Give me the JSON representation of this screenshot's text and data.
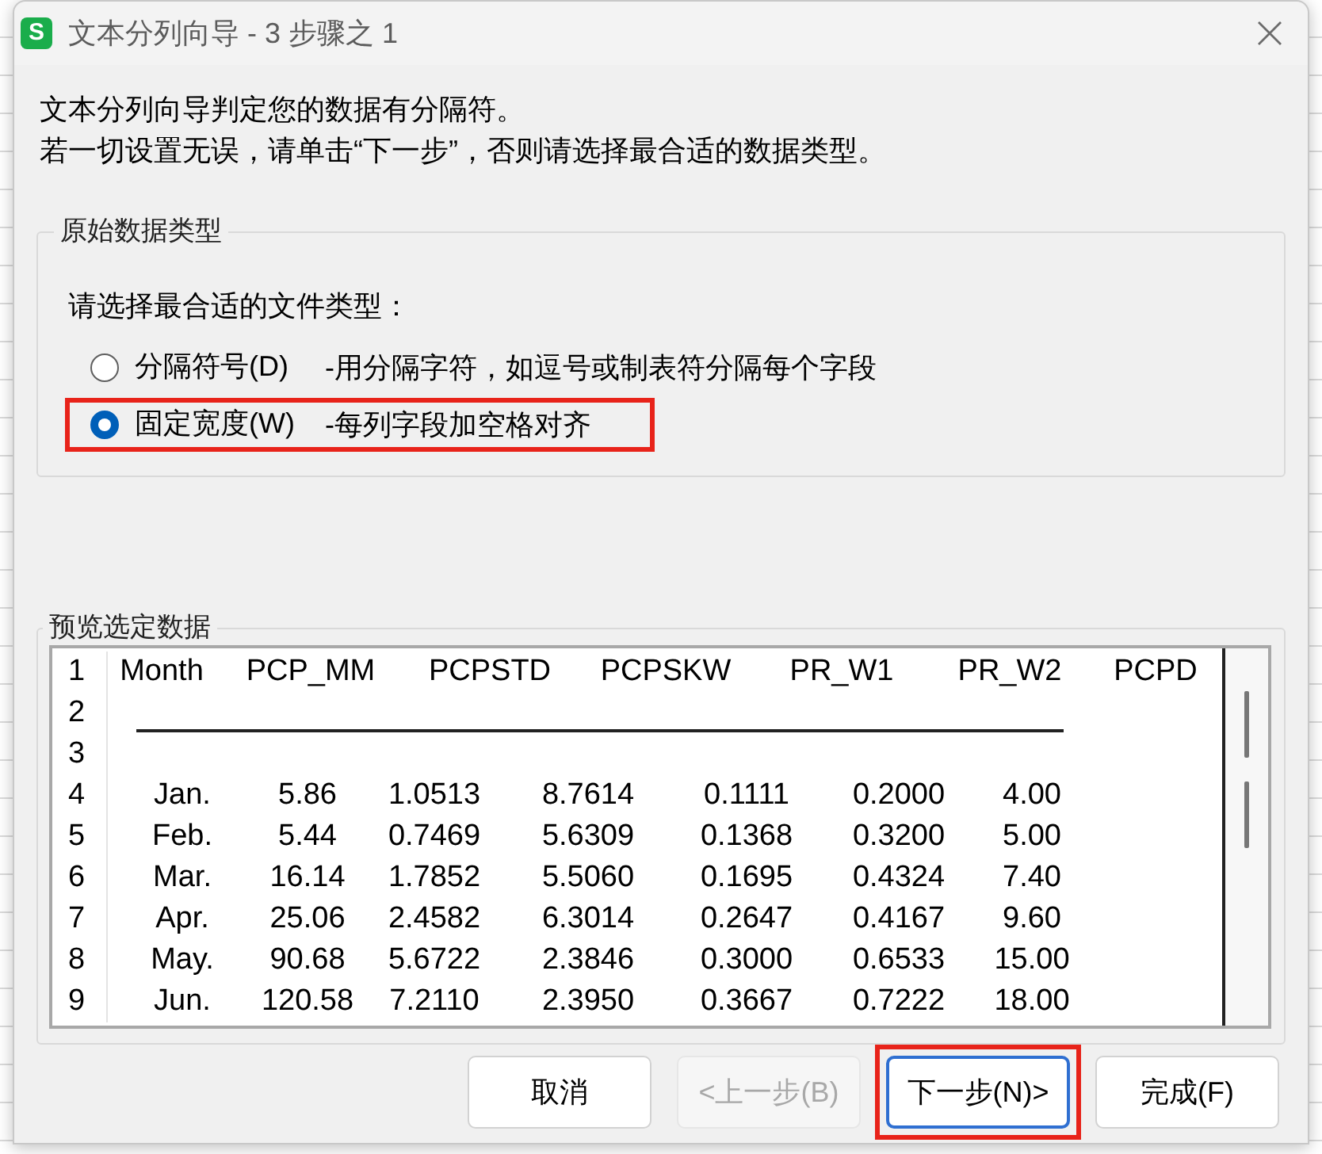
{
  "window": {
    "title": "文本分列向导 - 3 步骤之 1",
    "logo_letter": "S"
  },
  "intro": [
    "文本分列向导判定您的数据有分隔符。",
    "若一切设置无误，请单击“下一步”，否则请选择最合适的数据类型。"
  ],
  "data_type_group": {
    "legend": "原始数据类型",
    "prompt": "请选择最合适的文件类型：",
    "options": [
      {
        "label": "分隔符号(D)",
        "description": "-用分隔字符，如逗号或制表符分隔每个字段",
        "selected": false,
        "highlighted": false
      },
      {
        "label": "固定宽度(W)",
        "description": "-每列字段加空格对齐",
        "selected": true,
        "highlighted": true
      }
    ]
  },
  "preview": {
    "legend": "预览选定数据",
    "lines": [
      {
        "number": "1",
        "kind": "labels",
        "cells": [
          "Month",
          "PCP_MM",
          "PCPSTD",
          "PCPSKW",
          "PR_W1",
          "PR_W2",
          "PCPD"
        ]
      },
      {
        "number": "2",
        "kind": "rule"
      },
      {
        "number": "3",
        "kind": "blank"
      },
      {
        "number": "4",
        "kind": "values",
        "cells": [
          "Jan.",
          "5.86",
          "1.0513",
          "8.7614",
          "0.1111",
          "0.2000",
          "4.00"
        ]
      },
      {
        "number": "5",
        "kind": "values",
        "cells": [
          "Feb.",
          "5.44",
          "0.7469",
          "5.6309",
          "0.1368",
          "0.3200",
          "5.00"
        ]
      },
      {
        "number": "6",
        "kind": "values",
        "cells": [
          "Mar.",
          "16.14",
          "1.7852",
          "5.5060",
          "0.1695",
          "0.4324",
          "7.40"
        ]
      },
      {
        "number": "7",
        "kind": "values",
        "cells": [
          "Apr.",
          "25.06",
          "2.4582",
          "6.3014",
          "0.2647",
          "0.4167",
          "9.60"
        ]
      },
      {
        "number": "8",
        "kind": "values",
        "cells": [
          "May.",
          "90.68",
          "5.6722",
          "2.3846",
          "0.3000",
          "0.6533",
          "15.00"
        ]
      },
      {
        "number": "9",
        "kind": "values",
        "cells": [
          "Jun.",
          "120.58",
          "7.2110",
          "2.3950",
          "0.3667",
          "0.7222",
          "18.00"
        ]
      }
    ]
  },
  "buttons": [
    {
      "label": "取消",
      "disabled": false,
      "focused": false,
      "highlighted": false
    },
    {
      "label": "<上一步(B)",
      "disabled": true,
      "focused": false,
      "highlighted": false
    },
    {
      "label": "下一步(N)>",
      "disabled": false,
      "focused": true,
      "highlighted": true
    },
    {
      "label": "完成(F)",
      "disabled": false,
      "focused": false,
      "highlighted": false
    }
  ]
}
